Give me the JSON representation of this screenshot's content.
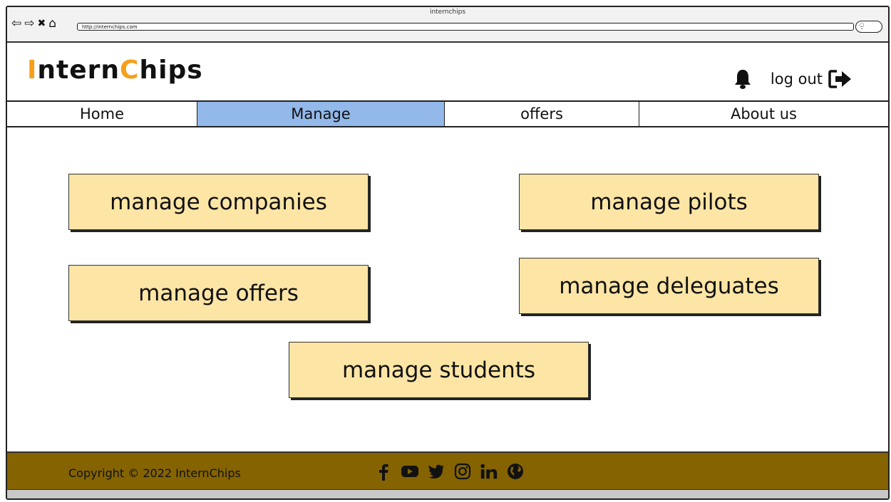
{
  "browser": {
    "title": "internchips",
    "url": "http://internchips.com"
  },
  "header": {
    "logo_parts": [
      "I",
      "ntern",
      "C",
      "hips"
    ],
    "logout_label": "log out"
  },
  "nav": {
    "tabs": [
      {
        "label": "Home"
      },
      {
        "label": "Manage"
      },
      {
        "label": "offers"
      },
      {
        "label": "About us"
      }
    ],
    "active_tab": "Manage"
  },
  "main": {
    "buttons": {
      "companies": "manage companies",
      "pilots": "manage pilots",
      "offers": "manage offers",
      "delegates": "manage deleguates",
      "students": "manage students"
    }
  },
  "footer": {
    "copyright": "Copyright © 2022 InternChips",
    "social_icons": [
      "facebook-icon",
      "youtube-icon",
      "twitter-icon",
      "instagram-icon",
      "linkedin-icon",
      "globe-icon"
    ]
  },
  "colors": {
    "accent_orange": "#f5a01a",
    "active_tab": "#93b8ea",
    "button_fill": "#fde5a5",
    "footer_bg": "#846300"
  }
}
